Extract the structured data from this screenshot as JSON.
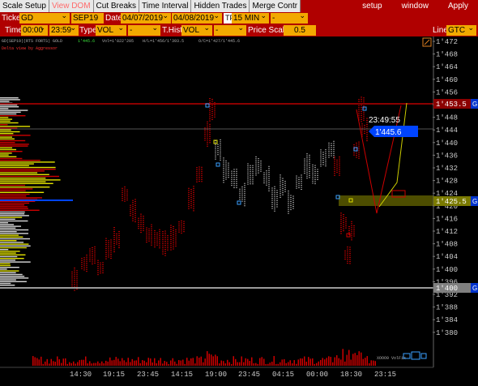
{
  "menubar": {
    "tabs": [
      "Scale Setup",
      "View DOM",
      "Cut Breaks",
      "Time Interval",
      "Hidden Trades",
      "Merge Contr"
    ],
    "right": [
      "setup",
      "window",
      "Apply"
    ]
  },
  "row1": {
    "ticker_label": "Ticker",
    "ticker_value": "GD",
    "month_value": "SEP19",
    "date_label": "Date",
    "date_from": "04/07/2019",
    "date_to": "04/08/2019",
    "tf_label": "TF",
    "tf_value": "15 MIN",
    "extra_value": "-"
  },
  "row2": {
    "time_label": "Time",
    "time_from": "00:00",
    "time_to": "23:59",
    "type_label": "Type",
    "type_value": "VOL",
    "type_extra": "-",
    "thist_label": "T.Hist",
    "thist_value": "VOL",
    "thist_extra": "-",
    "price_scale_label": "Price Scale",
    "price_scale_value": "0.5",
    "line_label": "Line",
    "line_value": "GTC"
  },
  "chart": {
    "header_text": "GD(SEP19)(RTS FORTS) GOLD",
    "header_stats": [
      "1'445.6",
      "Vol=1'822'205",
      "H/L=1'456/1'393.5",
      "O/C=1'427/1'445.6"
    ],
    "subtitle": "Delta view by Aggressor",
    "y_ticks": [
      "1'472",
      "1'468",
      "1'464",
      "1'460",
      "1'456",
      "1'452",
      "1'448",
      "1'444",
      "1'440",
      "1'436",
      "1'432",
      "1'428",
      "1'424",
      "1'420",
      "1'416",
      "1'412",
      "1'408",
      "1'404",
      "1'400",
      "1'396",
      "1'392",
      "1'388",
      "1'384",
      "1'380"
    ],
    "x_ticks": [
      "14:30",
      "19:15",
      "23:45",
      "14:15",
      "19:00",
      "23:45",
      "04:15",
      "00:00",
      "18:30",
      "23:15"
    ],
    "price_tags": [
      {
        "label": "1'453.5",
        "color": "#8b0000",
        "flag": "G"
      },
      {
        "label": "1'425.5",
        "color": "#7a7a00",
        "flag": "G"
      },
      {
        "label": "1'400",
        "color": "#808080",
        "flag": "G"
      }
    ],
    "countdown": "23:49:55",
    "last_price": "1'445.6",
    "accent_blue": "#0044ff",
    "bottom_text": "XOOO9 VolFix"
  }
}
